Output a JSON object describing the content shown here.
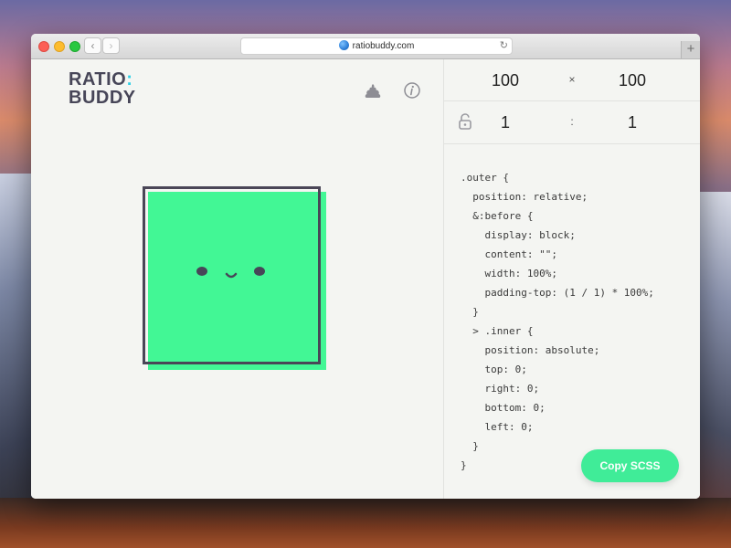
{
  "browser": {
    "url": "ratiobuddy.com",
    "back_label": "‹",
    "forward_label": "›",
    "reload_label": "↻",
    "new_tab_label": "+"
  },
  "logo": {
    "line1_text": "RATIO",
    "line1_colon": ":",
    "line2": "BUDDY"
  },
  "header_icons": [
    "poop-icon",
    "info-icon"
  ],
  "dimensions": {
    "width": "100",
    "height": "100",
    "times_symbol": "×",
    "ratio_left": "1",
    "ratio_right": "1",
    "ratio_separator": ":"
  },
  "code_lines": [
    ".outer {",
    "  position: relative;",
    "  &:before {",
    "    display: block;",
    "    content: \"\";",
    "    width: 100%;",
    "    padding-top: (1 / 1) * 100%;",
    "  }",
    "  > .inner {",
    "    position: absolute;",
    "    top: 0;",
    "    right: 0;",
    "    bottom: 0;",
    "    left: 0;",
    "  }",
    "}"
  ],
  "copy_button_label": "Copy SCSS",
  "colors": {
    "accent_green": "#42f795",
    "button_green": "#40ec98",
    "outline": "#4a4657",
    "logo_text": "#474658",
    "logo_colon": "#2ed0e6"
  }
}
